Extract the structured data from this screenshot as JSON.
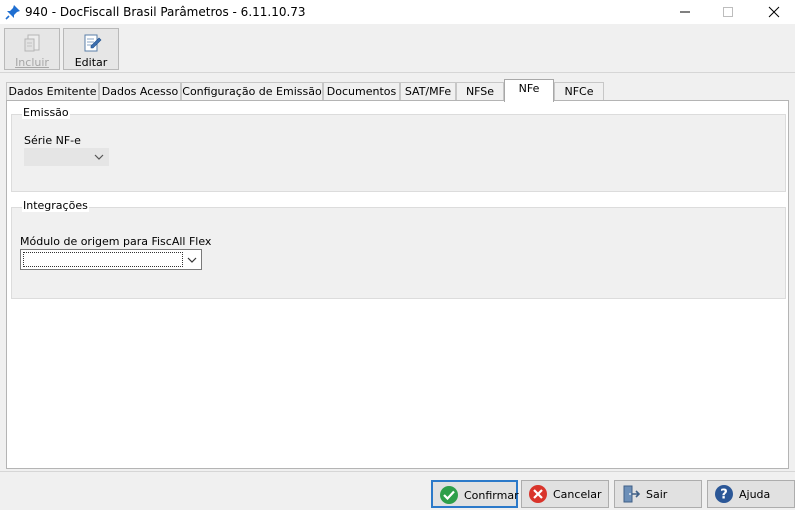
{
  "window": {
    "title": "940 - DocFiscall Brasil Parâmetros - 6.11.10.73",
    "icon": "pin-icon"
  },
  "toolbar": {
    "incluir_label": "Incluir",
    "editar_label": "Editar"
  },
  "tabs": [
    {
      "label": "Dados Emitente"
    },
    {
      "label": "Dados Acesso"
    },
    {
      "label": "Configuração de Emissão"
    },
    {
      "label": "Documentos"
    },
    {
      "label": "SAT/MFe"
    },
    {
      "label": "NFSe"
    },
    {
      "label": "NFe",
      "active": true
    },
    {
      "label": "NFCe"
    }
  ],
  "emissao": {
    "group_title": "Emissão",
    "serie_label": "Série NF-e",
    "serie_value": ""
  },
  "integracoes": {
    "group_title": "Integrações",
    "modulo_label": "Módulo de origem para FiscAll Flex",
    "modulo_value": ""
  },
  "buttons": {
    "confirmar": "Confirmar",
    "cancelar": "Cancelar",
    "sair": "Sair",
    "ajuda": "Ajuda"
  },
  "colors": {
    "confirm_green": "#2e9f4a",
    "cancel_red": "#d9342b",
    "help_blue": "#2b5797",
    "default_border": "#2b79c9"
  }
}
